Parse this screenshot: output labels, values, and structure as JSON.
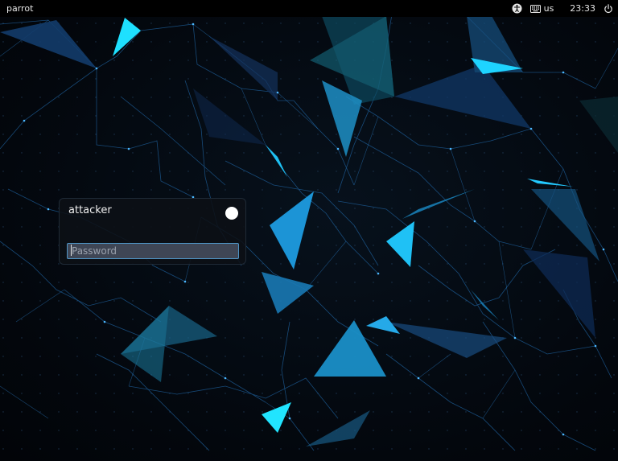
{
  "top_panel": {
    "hostname": "parrot",
    "accessibility_icon": "accessibility-icon",
    "keyboard_icon": "keyboard-icon",
    "keyboard_layout": "us",
    "clock": "23:33",
    "power_icon": "power-icon"
  },
  "login": {
    "username": "attacker",
    "session_icon": "session-indicator",
    "password": {
      "value": "",
      "placeholder": "Password"
    }
  },
  "colors": {
    "panel_bg": "#000000",
    "card_bg": "#0c1016",
    "field_border": "#4e93c4",
    "accent_cyan": "#19c8f5",
    "wallpaper_bg": "#03070d"
  }
}
